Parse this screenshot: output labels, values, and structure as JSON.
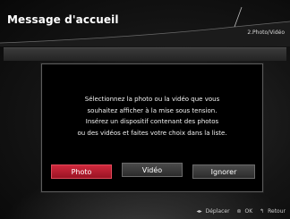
{
  "header": {
    "title": "Message d'accueil",
    "step": "2.Photo/Vidéo"
  },
  "dialog": {
    "lines": [
      "Sélectionnez la photo ou la vidéo que vous",
      "souhaitez afficher à la mise sous tension.",
      "Insérez un dispositif contenant des photos",
      "ou des vidéos et faites votre choix dans la liste."
    ],
    "buttons": {
      "photo": "Photo",
      "video": "Vidéo",
      "ignore": "Ignorer"
    }
  },
  "footer": {
    "move_icon": "◂▸",
    "move_label": "Déplacer",
    "ok_icon": "⊚",
    "ok_label": "OK",
    "return_icon": "↰",
    "return_label": "Retour"
  },
  "colors": {
    "selected_button": "#c42034",
    "background": "#141414"
  }
}
